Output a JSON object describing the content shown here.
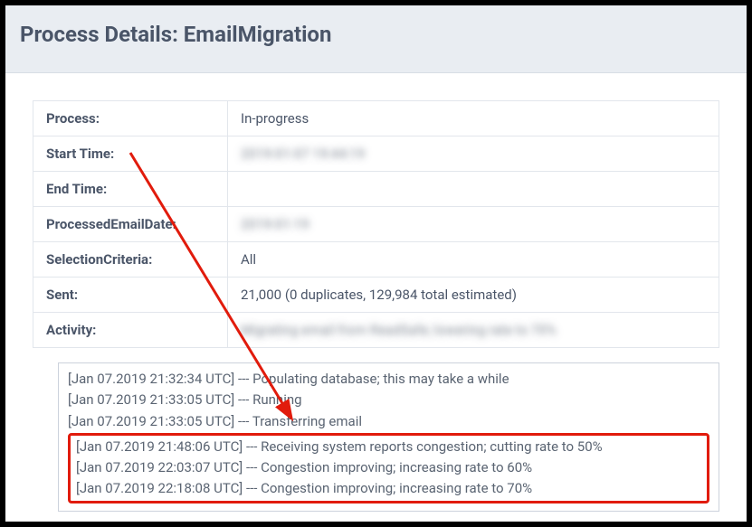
{
  "header": {
    "title": "Process Details: EmailMigration"
  },
  "details": {
    "process": {
      "label": "Process:",
      "value": "In-progress"
    },
    "start_time": {
      "label": "Start Time:",
      "value": "2019-01-07 19:44:19"
    },
    "end_time": {
      "label": "End Time:",
      "value": ""
    },
    "processed_date": {
      "label": "ProcessedEmailDate:",
      "value": "2019-01-19"
    },
    "selection_criteria": {
      "label": "SelectionCriteria:",
      "value": "All"
    },
    "sent": {
      "label": "Sent:",
      "value": "21,000 (0 duplicates, 129,984 total estimated)"
    },
    "activity": {
      "label": "Activity:",
      "value": "Migrating email from ReadSafe; lowering rate to 70%"
    }
  },
  "log": {
    "plain": [
      "[Jan 07.2019 21:32:34 UTC] --- Populating database; this may take a while",
      "[Jan 07.2019 21:33:05 UTC] --- Running",
      "[Jan 07.2019 21:33:05 UTC] --- Transferring email"
    ],
    "highlighted": [
      "[Jan 07.2019 21:48:06 UTC] --- Receiving system reports congestion; cutting rate to 50%",
      "[Jan 07.2019 22:03:07 UTC] --- Congestion improving; increasing rate to 60%",
      "[Jan 07.2019 22:18:08 UTC] --- Congestion improving; increasing rate to 70%"
    ]
  }
}
